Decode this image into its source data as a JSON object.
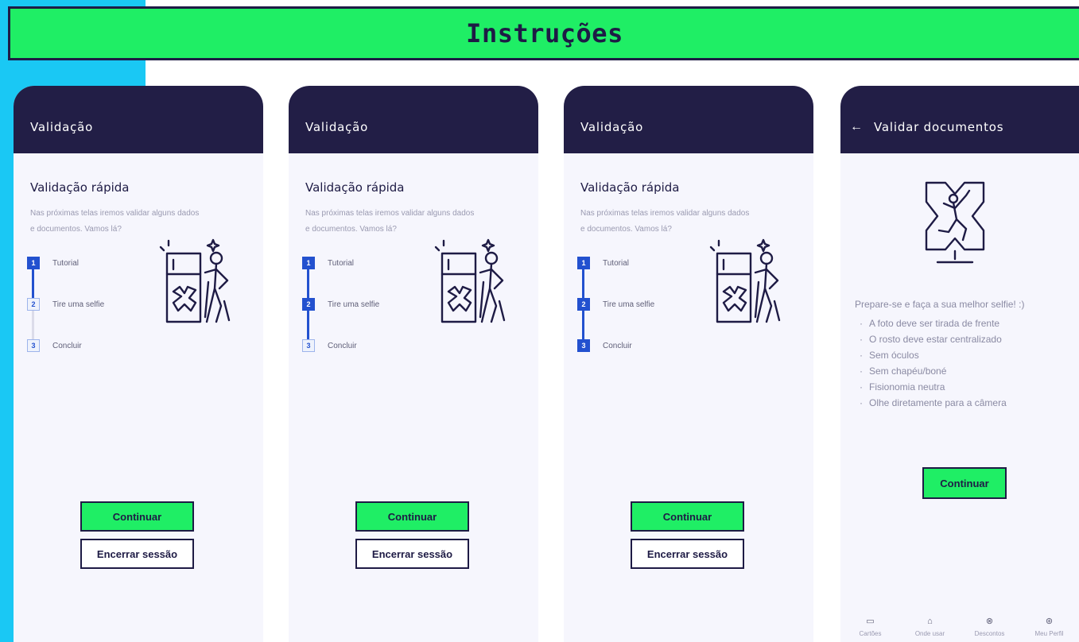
{
  "banner": {
    "title": "Instruções"
  },
  "screens": [
    {
      "header_title": "Validação",
      "section_title": "Validação rápida",
      "description": "Nas próximas telas iremos validar alguns dados e documentos. Vamos lá?",
      "steps": [
        {
          "number": "1",
          "label": "Tutorial",
          "active": true
        },
        {
          "number": "2",
          "label": "Tire uma selfie",
          "active": false
        },
        {
          "number": "3",
          "label": "Concluir",
          "active": false
        }
      ],
      "primary_button": "Continuar",
      "secondary_button": "Encerrar sessão"
    },
    {
      "header_title": "Validação",
      "section_title": "Validação rápida",
      "description": "Nas próximas telas iremos validar alguns dados e documentos. Vamos lá?",
      "steps": [
        {
          "number": "1",
          "label": "Tutorial",
          "active": true
        },
        {
          "number": "2",
          "label": "Tire uma selfie",
          "active": true
        },
        {
          "number": "3",
          "label": "Concluir",
          "active": false
        }
      ],
      "primary_button": "Continuar",
      "secondary_button": "Encerrar sessão"
    },
    {
      "header_title": "Validação",
      "section_title": "Validação rápida",
      "description": "Nas próximas telas iremos validar alguns dados e documentos. Vamos lá?",
      "steps": [
        {
          "number": "1",
          "label": "Tutorial",
          "active": true
        },
        {
          "number": "2",
          "label": "Tire uma selfie",
          "active": true
        },
        {
          "number": "3",
          "label": "Concluir",
          "active": true
        }
      ],
      "primary_button": "Continuar",
      "secondary_button": "Encerrar sessão"
    },
    {
      "header_title": "Validar documentos",
      "intro": "Prepare-se e faça a sua melhor selfie! :)",
      "instructions": [
        "A foto deve ser tirada de frente",
        "O rosto deve estar centralizado",
        "Sem óculos",
        "Sem chapéu/boné",
        "Fisionomia neutra",
        "Olhe diretamente para a câmera"
      ],
      "primary_button": "Continuar",
      "nav": [
        {
          "label": "Cartões",
          "icon": "card-icon"
        },
        {
          "label": "Onde usar",
          "icon": "store-icon"
        },
        {
          "label": "Descontos",
          "icon": "discount-icon"
        },
        {
          "label": "Meu Perfil",
          "icon": "profile-icon"
        }
      ]
    }
  ],
  "colors": {
    "accent_green": "#1fee65",
    "dark_navy": "#221e46",
    "step_blue": "#2351cf",
    "side_cyan": "#1ac8f4"
  }
}
